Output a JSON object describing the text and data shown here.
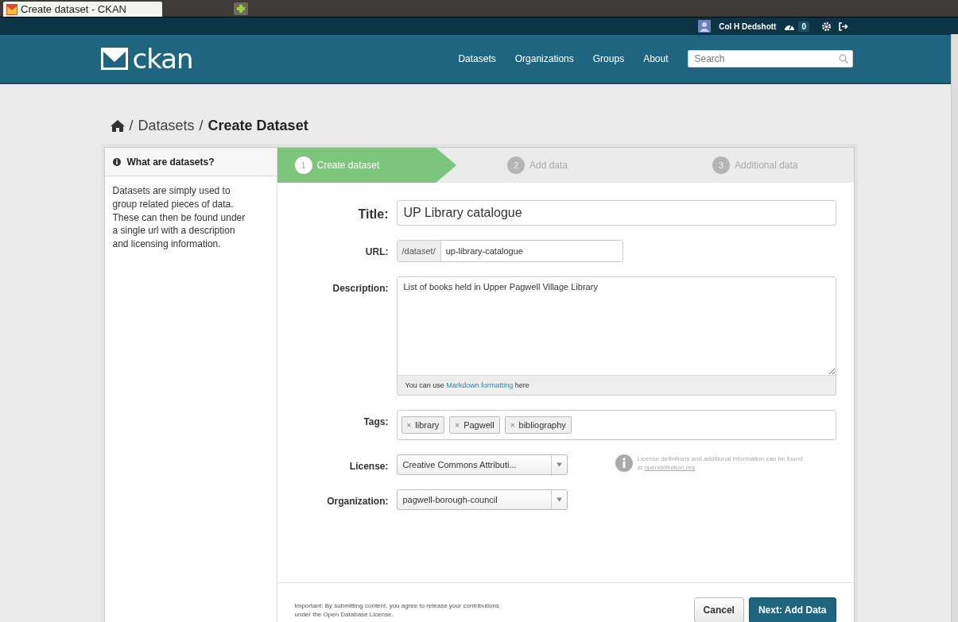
{
  "browser_tab": {
    "title": "Create dataset - CKAN"
  },
  "account": {
    "user": "Col H Dedshott",
    "dashboard_count": "0"
  },
  "nav": {
    "logo": "ckan",
    "links": [
      "Datasets",
      "Organizations",
      "Groups",
      "About"
    ],
    "search": {
      "placeholder": "Search"
    }
  },
  "breadcrumb": {
    "items": [
      {
        "separator": "/",
        "label": "Datasets"
      }
    ],
    "current": {
      "separator": "/",
      "label": "Create Dataset"
    }
  },
  "sidebar": {
    "heading": "What are datasets?",
    "text": "Datasets are simply used to group related pieces of data. These can then be found under a single url with a description and licensing information."
  },
  "stages": [
    {
      "number": "1",
      "label": "Create dataset",
      "selected": true
    },
    {
      "number": "2",
      "label": "Add data",
      "selected": false
    },
    {
      "number": "3",
      "label": "Additional data",
      "selected": false
    }
  ],
  "fields": [
    {
      "kind": "title",
      "label": "Title:",
      "value": "UP Library catalogue"
    },
    {
      "kind": "url",
      "label": "URL:",
      "prefix": "/dataset/",
      "value": "up-library-catalogue"
    },
    {
      "kind": "textarea",
      "label": "Description:",
      "value": "List of books held in Upper Pagwell Village Library",
      "hint_before": "You can use",
      "hint_link": "Markdown formatting",
      "hint_after": "here"
    },
    {
      "kind": "tags",
      "label": "Tags:",
      "tags": [
        {
          "remove": "×",
          "label": "library"
        },
        {
          "remove": "×",
          "label": "Pagwell"
        },
        {
          "remove": "×",
          "label": "bibliography"
        }
      ]
    },
    {
      "kind": "select",
      "label": "License:",
      "value": "Creative Commons Attributi...",
      "info": "License definitions and additional information can be found at",
      "info_link": "opendefinition.org"
    },
    {
      "kind": "select",
      "label": "Organization:",
      "value": "pagwell-borough-council"
    }
  ],
  "footer": {
    "notice": "Important: By submitting content, you agree to release your contributions under the Open Database License.",
    "buttons": [
      {
        "label": "Cancel",
        "primary": false
      },
      {
        "label": "Next: Add Data",
        "primary": true
      }
    ]
  }
}
